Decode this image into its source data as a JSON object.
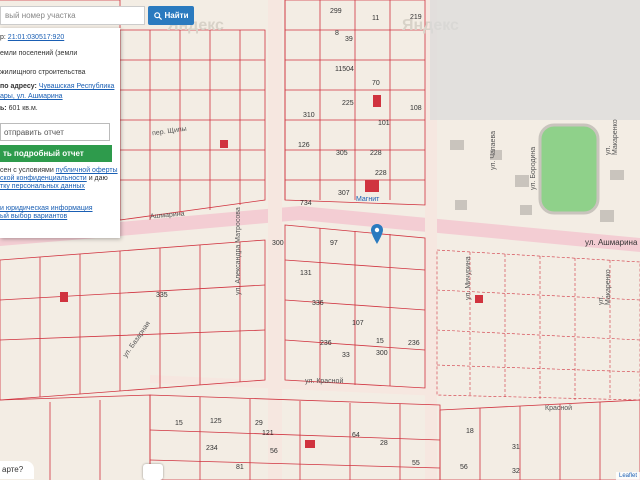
{
  "search": {
    "placeholder": "вый номер участка",
    "button_label": "Найти"
  },
  "panel": {
    "cadastral_label": "р:",
    "cadastral_number": "21:01:030517:920",
    "category": "емли поселений (земли",
    "usage": "жилищного строительства",
    "address_label": "по адресу:",
    "address_value": "Чувашская Республика",
    "address_line2": "ары, ул. Ашмарина",
    "area_label": "ь:",
    "area_value": "601 кв.м.",
    "send_placeholder": "отправить отчет",
    "report_button": "ть подробный отчет",
    "terms_1": "сен с условиями",
    "terms_link": "публичной оферты",
    "terms_2": "ской конфиденциальности",
    "terms_3": "и даю",
    "terms_4": "тку персональных данных",
    "info_link": "и юридическая информация",
    "variants_link": "ый выбор вариантов"
  },
  "map": {
    "logo_text": "Яндекс",
    "street_ashmarina": "ул. Ашмарина",
    "street_ashmarina2": "Ашмарина",
    "street_shchipy": "пер. Щипы",
    "street_aleksandra_matrosova": "ул. Александра Матросова",
    "street_krasnoy": "ул. Красной",
    "street_krasnoi2": "Красной",
    "street_makarenko": "ул. Макаренко",
    "street_makarenko2": "ул. Макаренко",
    "street_vorona": "ул. Чапаева",
    "street_borodina": "ул. Бородина",
    "street_vishnevaya": "ул. Мичурина",
    "street_bazarnaya": "ул. Базарная",
    "store_label": "Магнит",
    "parcel_labels": [
      "299",
      "8",
      "219",
      "11",
      "11504",
      "39",
      "70",
      "225",
      "108",
      "310",
      "101",
      "126",
      "305",
      "228",
      "228",
      "734",
      "307",
      "300",
      "97",
      "131",
      "336",
      "335",
      "236",
      "107",
      "15",
      "33",
      "300",
      "236",
      "234",
      "56",
      "125",
      "121",
      "81",
      "64",
      "55",
      "18",
      "31",
      "32",
      "56",
      "28",
      "15",
      "29"
    ],
    "hint_text": "арте?",
    "attribution": "Leaflet"
  },
  "colors": {
    "accent": "#2a7abf",
    "report": "#2e9b4c",
    "parcel_border": "#d0333f",
    "road": "#f5dce0"
  }
}
